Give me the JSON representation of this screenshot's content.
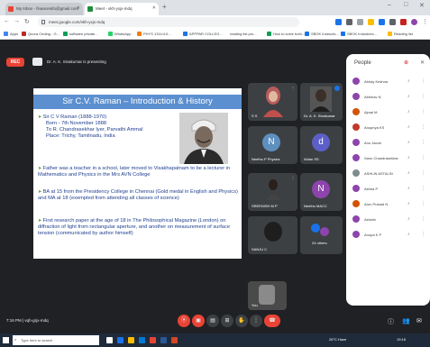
{
  "browser": {
    "tabs": [
      {
        "label": "My Inbox - financeinfo@gmail.com",
        "color": "#ea4335"
      },
      {
        "label": "Meet - vkh-yxjx-mdq",
        "color": "#1e8e3e"
      }
    ],
    "new_tab": "+",
    "url": "meet.google.com/vkh-yxjx-mdq",
    "bookmarks": [
      "Apps",
      "Quora Ceding - G...",
      "software private...",
      "WhatsApp",
      "PHYS 1311/4:0...",
      "APPPAR COLLEG...",
      "reading list pru...",
      "How to solve both...",
      "SBOK Instructs...",
      "SBOK Industries...",
      "Reading list"
    ]
  },
  "meeting": {
    "recording_badge": "REC",
    "presenting_text": "Dr. A. K. Sivakumar is presenting",
    "meeting_code": "7:16 PM | vqh-grjx-mdq"
  },
  "slide": {
    "title": "Sir C.V. Raman – Introduction & History",
    "line1": "Sir C V Raman (1888-1970)",
    "line2": "Born - 7th November 1888",
    "line3": "To R. Chandrasekhar Iyer, Parvathi Ammal",
    "line4": "Place: Trichy, Tamilnadu, India",
    "para1": "Father was a teacher in a school, later moved to Visakhapatnam to be a lecturer in Mathematics and Physics in the Mrs AVN College",
    "para2": "BA at 15 from the Presidency College in Chennai (Gold medal in English and Physics) and MA at 18 (exempted from attending all classes of science)",
    "para3": "First research paper at the age of 18 in The Philosophical Magazine (London) on diffraction of light from rectangular aperture, and another on measurement of surface tension (communicated by author himself)"
  },
  "tiles": [
    {
      "name": "S S",
      "type": "photo"
    },
    {
      "name": "Dr. A. K. Sivakumar",
      "type": "photo"
    },
    {
      "name": "Neethu P Physics",
      "letter": "N",
      "color": "#5f8fbf"
    },
    {
      "name": "Ahlan SS",
      "letter": "d",
      "color": "#5b5fc7"
    },
    {
      "name": "SREENISH M P",
      "type": "photo"
    },
    {
      "name": "Neethu MACC",
      "letter": "N",
      "color": "#8e44ad"
    },
    {
      "name": "SANJU C",
      "type": "photo"
    },
    {
      "name": "24 others",
      "type": "others"
    },
    {
      "name": "You",
      "type": "self"
    }
  ],
  "people": {
    "title": "People",
    "list": [
      {
        "name": "Abhay Krishna",
        "color": "#8e44ad"
      },
      {
        "name": "Abhinav N",
        "color": "#8e44ad"
      },
      {
        "name": "Ajmal M",
        "color": "#d35400"
      },
      {
        "name": "Anupriya KS",
        "color": "#c0392b"
      },
      {
        "name": "Anu Jacob",
        "color": "#8e44ad"
      },
      {
        "name": "Sanu Chandrasekhar",
        "color": "#8e44ad"
      },
      {
        "name": "ASHLIN ASTALIN",
        "color": "#7f8c8d"
      },
      {
        "name": "Ashna P",
        "color": "#8e44ad"
      },
      {
        "name": "Arun Prasad N",
        "color": "#d35400"
      },
      {
        "name": "Ashwin",
        "color": "#8e44ad"
      },
      {
        "name": "Anupa K P",
        "color": "#8e44ad"
      }
    ]
  },
  "controls": [
    "mic",
    "camera",
    "captions",
    "present",
    "raise",
    "more",
    "end"
  ],
  "taskbar": {
    "search_placeholder": "Type here to search",
    "weather": "26°C Haze",
    "time": "19:16"
  },
  "colors": {
    "accent": "#1a73e8",
    "end_call": "#ea4335",
    "slide_title": "#5b8fd0"
  }
}
